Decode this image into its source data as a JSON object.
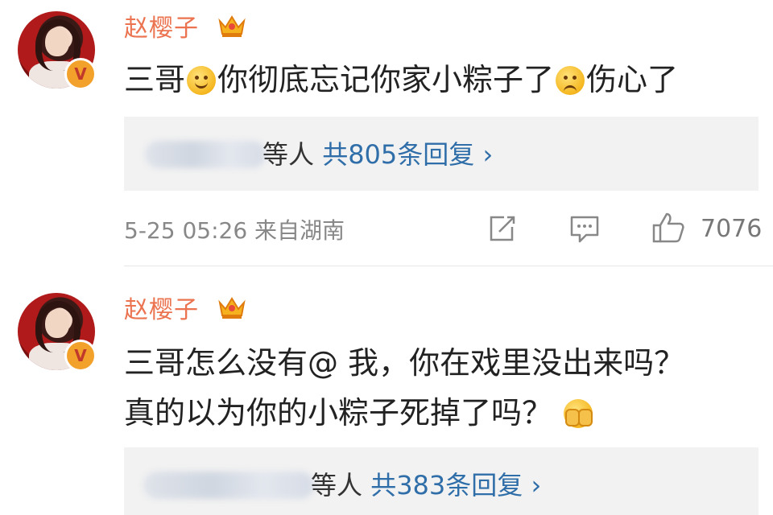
{
  "comments": [
    {
      "username": "赵樱子",
      "text_parts": [
        "三哥",
        "你彻底忘记你家小粽子了",
        "伤心了"
      ],
      "reply_summary": {
        "by_suffix": "等人",
        "count_text": "共805条回复",
        "chevron": "›"
      },
      "meta": "5-25 05:26  来自湖南",
      "likes": "7076",
      "icons": [
        "avatar",
        "verified-v-badge-icon",
        "crown-icon",
        "smile-emoji-icon",
        "sad-emoji-icon",
        "share-icon",
        "comment-icon",
        "like-icon"
      ]
    },
    {
      "username": "赵樱子",
      "text_line1": "三哥怎么没有@ 我，你在戏里没出来吗？",
      "text_line2": "真的以为你的小粽子死掉了吗？",
      "reply_summary": {
        "by_suffix": "等人",
        "count_text": "共383条回复",
        "chevron": "›"
      },
      "icons": [
        "avatar",
        "verified-v-badge-icon",
        "crown-icon",
        "covered-face-emoji-icon"
      ]
    }
  ],
  "colors": {
    "username": "#eb7350",
    "link": "#2f6ea8",
    "reply_bg": "#f2f2f2",
    "badge": "#f2a12b"
  }
}
